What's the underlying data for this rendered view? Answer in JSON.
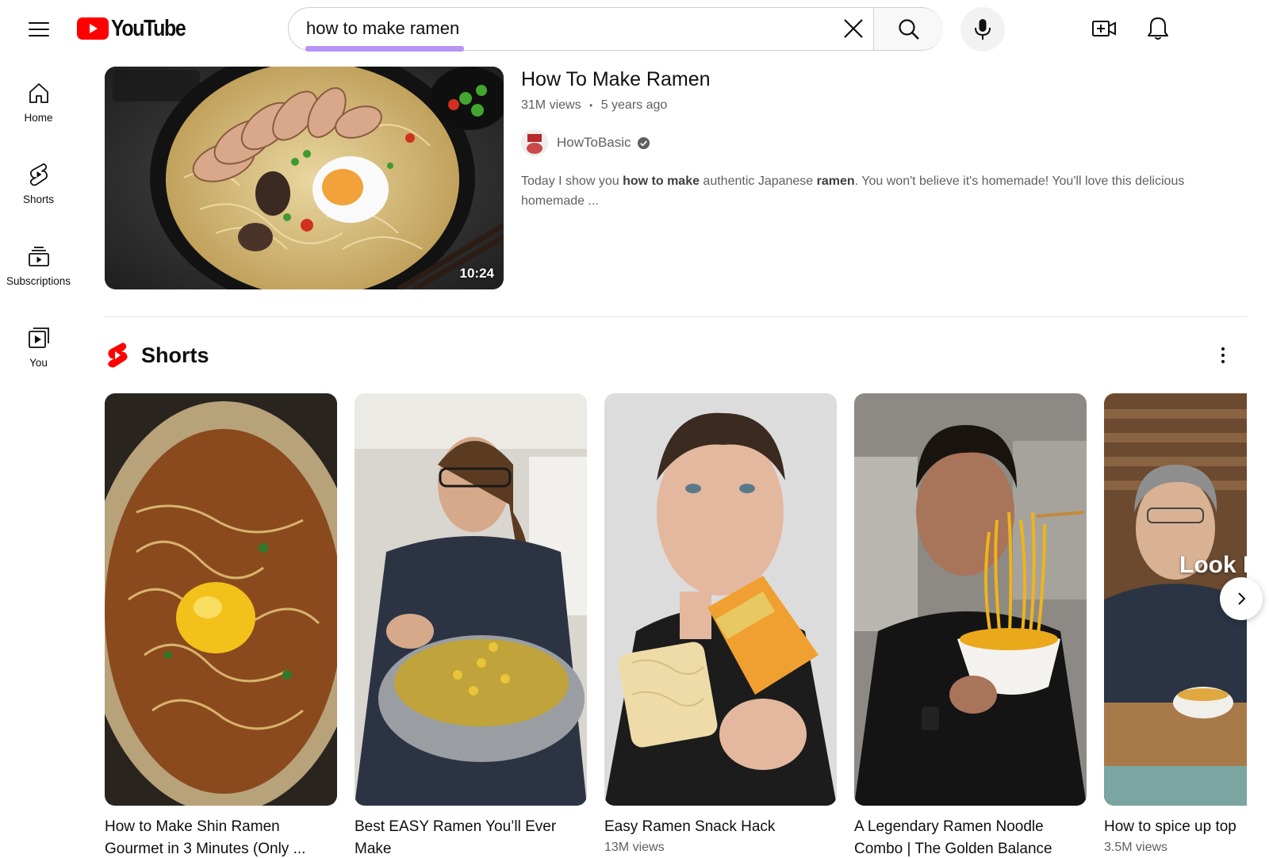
{
  "header": {
    "logo_text": "YouTube",
    "search_query": "how to make ramen",
    "brand_color": "#FF0000",
    "search_highlight_color": "#B794F6"
  },
  "sidebar": {
    "items": [
      {
        "label": "Home",
        "icon": "home-icon"
      },
      {
        "label": "Shorts",
        "icon": "shorts-icon"
      },
      {
        "label": "Subscriptions",
        "icon": "subscriptions-icon"
      },
      {
        "label": "You",
        "icon": "you-icon"
      }
    ]
  },
  "video": {
    "title": "How To Make Ramen",
    "views": "31M views",
    "separator": "•",
    "age": "5 years ago",
    "channel": "HowToBasic",
    "duration": "10:24",
    "description_parts": [
      {
        "text": "Today I show you ",
        "bold": false
      },
      {
        "text": "how to make",
        "bold": true
      },
      {
        "text": " authentic Japanese ",
        "bold": false
      },
      {
        "text": "ramen",
        "bold": true
      },
      {
        "text": ". You won't believe it's homemade! You'll love this delicious homemade ...",
        "bold": false
      }
    ]
  },
  "shorts": {
    "section_title": "Shorts",
    "items": [
      {
        "title": "How to Make Shin Ramen Gourmet in 3 Minutes (Only ...",
        "views": ""
      },
      {
        "title": "Best EASY Ramen You’ll Ever Make",
        "views": ""
      },
      {
        "title": "Easy Ramen Snack Hack",
        "views": "13M views"
      },
      {
        "title": "A Legendary Ramen Noodle Combo | The Golden Balance",
        "views": ""
      },
      {
        "title": "How to spice up top",
        "views": "3.5M views",
        "overlay_text": "Look L"
      }
    ]
  }
}
